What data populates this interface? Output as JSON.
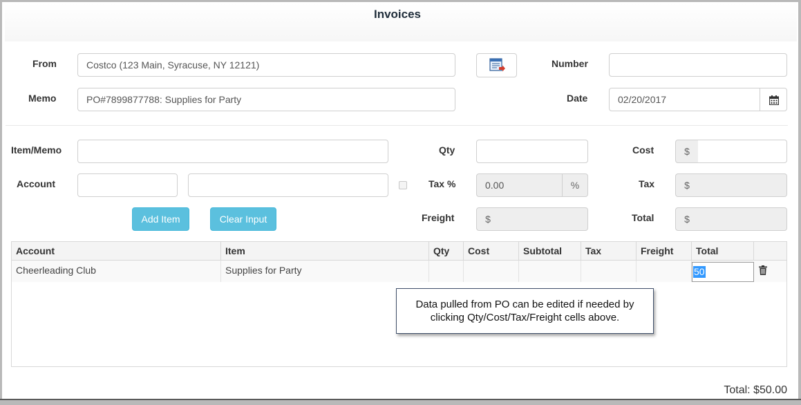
{
  "page": {
    "title": "Invoices"
  },
  "header_form": {
    "from_label": "From",
    "from_value": "Costco (123 Main, Syracuse, NY 12121)",
    "memo_label": "Memo",
    "memo_value": "PO#7899877788: Supplies for Party",
    "number_label": "Number",
    "number_value": "",
    "date_label": "Date",
    "date_value": "02/20/2017"
  },
  "item_form": {
    "item_memo_label": "Item/Memo",
    "account_label": "Account",
    "qty_label": "Qty",
    "tax_pct_label": "Tax %",
    "tax_pct_value": "0.00",
    "percent_symbol": "%",
    "freight_label": "Freight",
    "cost_label": "Cost",
    "tax_label": "Tax",
    "total_label": "Total",
    "currency_symbol": "$",
    "add_item_button": "Add Item",
    "clear_input_button": "Clear Input"
  },
  "table": {
    "columns": [
      "Account",
      "Item",
      "Qty",
      "Cost",
      "Subtotal",
      "Tax",
      "Freight",
      "Total"
    ],
    "rows": [
      {
        "account": "Cheerleading Club",
        "item": "Supplies for Party",
        "qty": "",
        "cost": "",
        "subtotal": "",
        "tax": "",
        "freight": "",
        "total": "50"
      }
    ]
  },
  "callout": {
    "line1": "Data pulled from PO can be edited if needed by",
    "line2": "clicking Qty/Cost/Tax/Freight cells above."
  },
  "footer": {
    "grand_total": "Total: $50.00"
  },
  "icons": {
    "vendor_lookup": "vendor-lookup-icon",
    "calendar": "calendar-icon",
    "delete": "trash-icon"
  },
  "colors": {
    "button_blue": "#5bc0de",
    "selection_blue": "#3399ff",
    "disabled_gray": "#eeeeee"
  }
}
